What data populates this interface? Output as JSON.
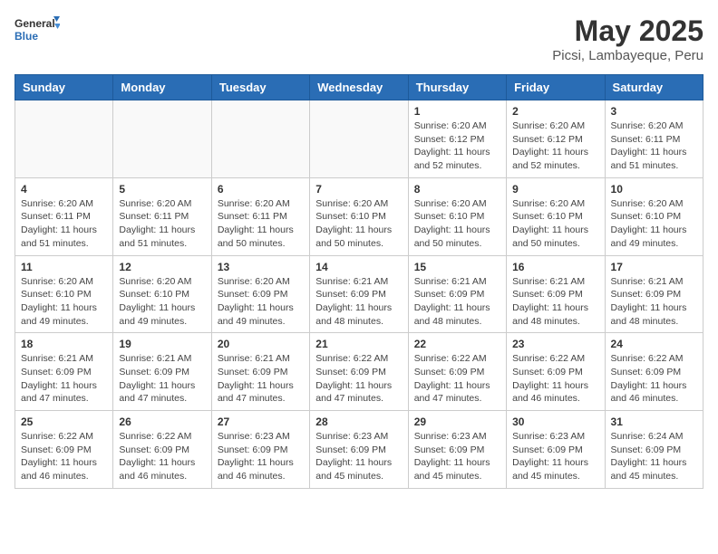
{
  "logo": {
    "general": "General",
    "blue": "Blue"
  },
  "title": "May 2025",
  "subtitle": "Picsi, Lambayeque, Peru",
  "days_of_week": [
    "Sunday",
    "Monday",
    "Tuesday",
    "Wednesday",
    "Thursday",
    "Friday",
    "Saturday"
  ],
  "weeks": [
    [
      {
        "day": "",
        "info": ""
      },
      {
        "day": "",
        "info": ""
      },
      {
        "day": "",
        "info": ""
      },
      {
        "day": "",
        "info": ""
      },
      {
        "day": "1",
        "info": "Sunrise: 6:20 AM\nSunset: 6:12 PM\nDaylight: 11 hours and 52 minutes."
      },
      {
        "day": "2",
        "info": "Sunrise: 6:20 AM\nSunset: 6:12 PM\nDaylight: 11 hours and 52 minutes."
      },
      {
        "day": "3",
        "info": "Sunrise: 6:20 AM\nSunset: 6:11 PM\nDaylight: 11 hours and 51 minutes."
      }
    ],
    [
      {
        "day": "4",
        "info": "Sunrise: 6:20 AM\nSunset: 6:11 PM\nDaylight: 11 hours and 51 minutes."
      },
      {
        "day": "5",
        "info": "Sunrise: 6:20 AM\nSunset: 6:11 PM\nDaylight: 11 hours and 51 minutes."
      },
      {
        "day": "6",
        "info": "Sunrise: 6:20 AM\nSunset: 6:11 PM\nDaylight: 11 hours and 50 minutes."
      },
      {
        "day": "7",
        "info": "Sunrise: 6:20 AM\nSunset: 6:10 PM\nDaylight: 11 hours and 50 minutes."
      },
      {
        "day": "8",
        "info": "Sunrise: 6:20 AM\nSunset: 6:10 PM\nDaylight: 11 hours and 50 minutes."
      },
      {
        "day": "9",
        "info": "Sunrise: 6:20 AM\nSunset: 6:10 PM\nDaylight: 11 hours and 50 minutes."
      },
      {
        "day": "10",
        "info": "Sunrise: 6:20 AM\nSunset: 6:10 PM\nDaylight: 11 hours and 49 minutes."
      }
    ],
    [
      {
        "day": "11",
        "info": "Sunrise: 6:20 AM\nSunset: 6:10 PM\nDaylight: 11 hours and 49 minutes."
      },
      {
        "day": "12",
        "info": "Sunrise: 6:20 AM\nSunset: 6:10 PM\nDaylight: 11 hours and 49 minutes."
      },
      {
        "day": "13",
        "info": "Sunrise: 6:20 AM\nSunset: 6:09 PM\nDaylight: 11 hours and 49 minutes."
      },
      {
        "day": "14",
        "info": "Sunrise: 6:21 AM\nSunset: 6:09 PM\nDaylight: 11 hours and 48 minutes."
      },
      {
        "day": "15",
        "info": "Sunrise: 6:21 AM\nSunset: 6:09 PM\nDaylight: 11 hours and 48 minutes."
      },
      {
        "day": "16",
        "info": "Sunrise: 6:21 AM\nSunset: 6:09 PM\nDaylight: 11 hours and 48 minutes."
      },
      {
        "day": "17",
        "info": "Sunrise: 6:21 AM\nSunset: 6:09 PM\nDaylight: 11 hours and 48 minutes."
      }
    ],
    [
      {
        "day": "18",
        "info": "Sunrise: 6:21 AM\nSunset: 6:09 PM\nDaylight: 11 hours and 47 minutes."
      },
      {
        "day": "19",
        "info": "Sunrise: 6:21 AM\nSunset: 6:09 PM\nDaylight: 11 hours and 47 minutes."
      },
      {
        "day": "20",
        "info": "Sunrise: 6:21 AM\nSunset: 6:09 PM\nDaylight: 11 hours and 47 minutes."
      },
      {
        "day": "21",
        "info": "Sunrise: 6:22 AM\nSunset: 6:09 PM\nDaylight: 11 hours and 47 minutes."
      },
      {
        "day": "22",
        "info": "Sunrise: 6:22 AM\nSunset: 6:09 PM\nDaylight: 11 hours and 47 minutes."
      },
      {
        "day": "23",
        "info": "Sunrise: 6:22 AM\nSunset: 6:09 PM\nDaylight: 11 hours and 46 minutes."
      },
      {
        "day": "24",
        "info": "Sunrise: 6:22 AM\nSunset: 6:09 PM\nDaylight: 11 hours and 46 minutes."
      }
    ],
    [
      {
        "day": "25",
        "info": "Sunrise: 6:22 AM\nSunset: 6:09 PM\nDaylight: 11 hours and 46 minutes."
      },
      {
        "day": "26",
        "info": "Sunrise: 6:22 AM\nSunset: 6:09 PM\nDaylight: 11 hours and 46 minutes."
      },
      {
        "day": "27",
        "info": "Sunrise: 6:23 AM\nSunset: 6:09 PM\nDaylight: 11 hours and 46 minutes."
      },
      {
        "day": "28",
        "info": "Sunrise: 6:23 AM\nSunset: 6:09 PM\nDaylight: 11 hours and 45 minutes."
      },
      {
        "day": "29",
        "info": "Sunrise: 6:23 AM\nSunset: 6:09 PM\nDaylight: 11 hours and 45 minutes."
      },
      {
        "day": "30",
        "info": "Sunrise: 6:23 AM\nSunset: 6:09 PM\nDaylight: 11 hours and 45 minutes."
      },
      {
        "day": "31",
        "info": "Sunrise: 6:24 AM\nSunset: 6:09 PM\nDaylight: 11 hours and 45 minutes."
      }
    ]
  ]
}
